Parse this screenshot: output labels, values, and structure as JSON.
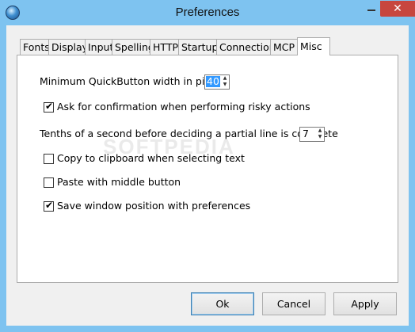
{
  "window": {
    "title": "Preferences",
    "icon": "app-globe-icon",
    "close_glyph": "✕"
  },
  "tabs": [
    {
      "label": "Fonts"
    },
    {
      "label": "Display"
    },
    {
      "label": "Input"
    },
    {
      "label": "Spelling"
    },
    {
      "label": "HTTP"
    },
    {
      "label": "Startup"
    },
    {
      "label": "Connection"
    },
    {
      "label": "MCP"
    },
    {
      "label": "Misc",
      "active": true
    }
  ],
  "misc": {
    "min_quickbutton_label": "Minimum QuickButton width in pixels",
    "min_quickbutton_value": "40",
    "risky_confirm_label": "Ask for confirmation when performing risky actions",
    "risky_confirm_checked": true,
    "tenths_label": "Tenths of a second before deciding a partial line is complete",
    "tenths_value": "7",
    "copy_clipboard_label": "Copy to clipboard when selecting text",
    "copy_clipboard_checked": false,
    "paste_middle_label": "Paste with middle button",
    "paste_middle_checked": false,
    "save_position_label": "Save window position with preferences",
    "save_position_checked": true
  },
  "buttons": {
    "ok": "Ok",
    "cancel": "Cancel",
    "apply": "Apply"
  },
  "watermark": "SOFTPEDIA"
}
